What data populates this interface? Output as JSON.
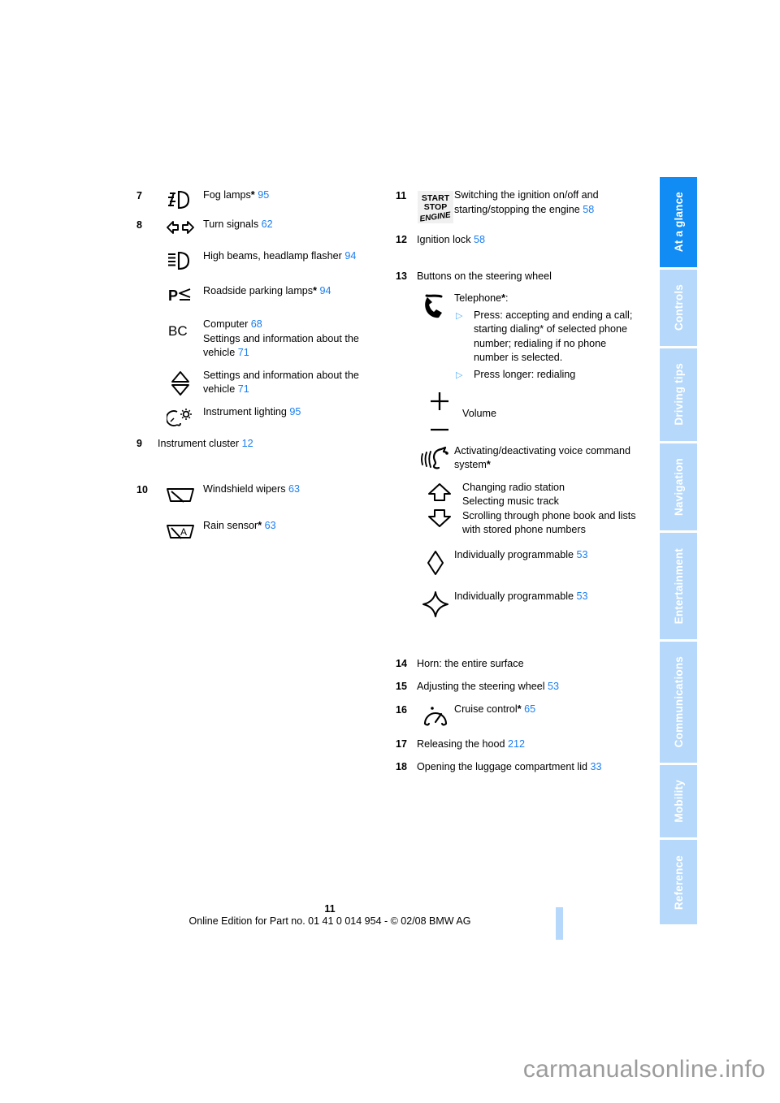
{
  "document": {
    "page_number": "11",
    "footer_line": "Online Edition for Part no. 01 41 0 014 954  - © 02/08 BMW AG",
    "watermark": "carmanualsonline.info"
  },
  "theme": {
    "link_blue": "#1a7ef0",
    "tab_active": "#118cf5",
    "tab_inactive": "#b6d8fa",
    "bullet_blue": "#55aef7"
  },
  "tabs": [
    {
      "label": "At a glance",
      "active": true
    },
    {
      "label": "Controls",
      "active": false
    },
    {
      "label": "Driving tips",
      "active": false
    },
    {
      "label": "Navigation",
      "active": false
    },
    {
      "label": "Entertainment",
      "active": false
    },
    {
      "label": "Communications",
      "active": false
    },
    {
      "label": "Mobility",
      "active": false
    },
    {
      "label": "Reference",
      "active": false
    }
  ],
  "left_column": {
    "item7": {
      "num": "7",
      "icon": "fog-lamps-icon",
      "label": "Fog lamps",
      "star": "*",
      "page": "95"
    },
    "item8": {
      "num": "8",
      "rows": [
        {
          "icon": "turn-signals-icon",
          "label": "Turn signals",
          "star": "",
          "page": "62"
        },
        {
          "icon": "high-beams-icon",
          "label": "High beams, headlamp flasher",
          "star": "",
          "page": "94"
        },
        {
          "icon": "roadside-parking-icon",
          "label": "Roadside parking lamps",
          "star": "*",
          "page": "94"
        }
      ],
      "computer": {
        "icon": "bc-computer-icon",
        "line1_label": "Computer",
        "line1_page": "68",
        "line2_label": "Settings and information about the vehicle",
        "line2_page": "71"
      },
      "updown": {
        "icon": "up-down-triangles-icon",
        "label": "Settings and information about the vehicle",
        "page": "71"
      },
      "instrument_lighting": {
        "icon": "instrument-lighting-icon",
        "label": "Instrument lighting",
        "page": "95"
      }
    },
    "item9": {
      "num": "9",
      "label": "Instrument cluster",
      "page": "12"
    },
    "item10": {
      "num": "10",
      "rows": [
        {
          "icon": "windshield-wipers-icon",
          "label": "Windshield wipers",
          "star": "",
          "page": "63"
        },
        {
          "icon": "rain-sensor-icon",
          "label": "Rain sensor",
          "star": "*",
          "page": "63"
        }
      ]
    }
  },
  "right_column": {
    "item11": {
      "num": "11",
      "icon": "start-stop-engine-icon",
      "icon_text": {
        "line1": "START",
        "line2": "STOP",
        "line3": "ENGINE"
      },
      "label": "Switching the ignition on/off and starting/stopping the engine",
      "page": "58"
    },
    "item12": {
      "num": "12",
      "label": "Ignition lock",
      "page": "58"
    },
    "item13": {
      "num": "13",
      "heading": "Buttons on the steering wheel",
      "telephone": {
        "icon": "telephone-handset-icon",
        "label": "Telephone",
        "star": "*",
        "colon": ":",
        "bullets": [
          "Press: accepting and ending a call; starting dialing* of selected phone number; redialing if no phone number is selected.",
          "Press longer: redialing"
        ]
      },
      "volume": {
        "icon_plus": "plus-icon",
        "icon_minus": "minus-icon",
        "label": "Volume"
      },
      "voice": {
        "icon": "voice-command-icon",
        "label": "Activating/deactivating voice command system",
        "star": "*"
      },
      "arrows": {
        "icon_up": "arrow-up-icon",
        "icon_down": "arrow-down-icon",
        "lines": [
          "Changing radio station",
          "Selecting music track",
          "Scrolling through phone book and lists with stored phone numbers"
        ]
      },
      "programmable": [
        {
          "icon": "diamond-icon",
          "label": "Individually programmable",
          "page": "53"
        },
        {
          "icon": "four-point-star-icon",
          "label": "Individually programmable",
          "page": "53"
        }
      ]
    },
    "item14": {
      "num": "14",
      "label": "Horn: the entire surface",
      "page": ""
    },
    "item15": {
      "num": "15",
      "label": "Adjusting the steering wheel",
      "page": "53"
    },
    "item16": {
      "num": "16",
      "icon": "cruise-control-icon",
      "label": "Cruise control",
      "star": "*",
      "page": "65"
    },
    "item17": {
      "num": "17",
      "label": "Releasing the hood",
      "page": "212"
    },
    "item18": {
      "num": "18",
      "label": "Opening the luggage compartment lid",
      "page": "33"
    }
  }
}
